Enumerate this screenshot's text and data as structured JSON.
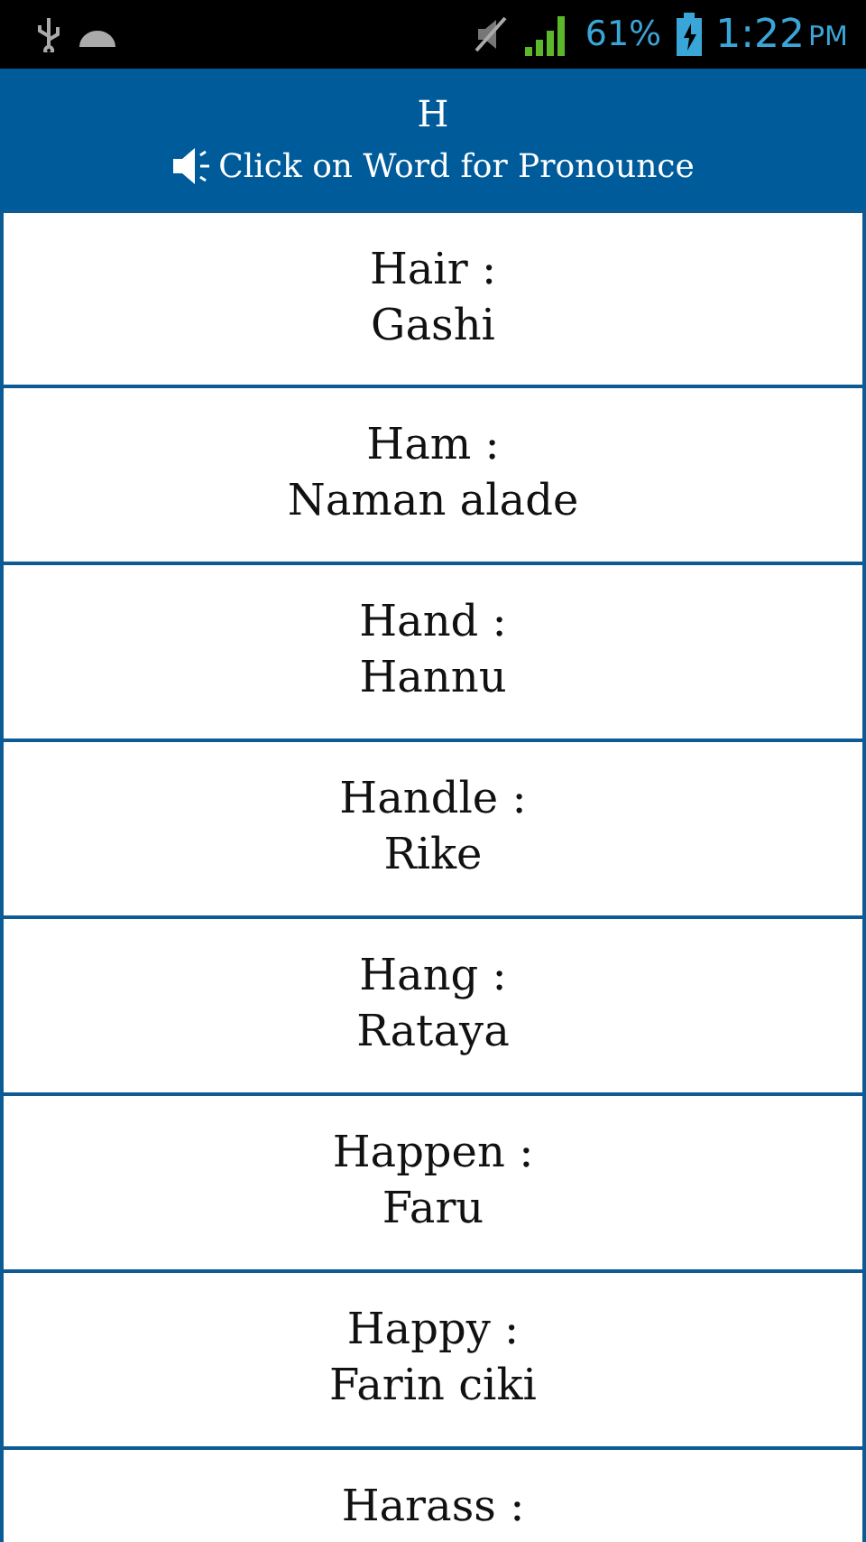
{
  "status_bar": {
    "battery": "61%",
    "time": "1:22",
    "ampm": "PM"
  },
  "header": {
    "title": "H",
    "hint": "Click on Word for Pronounce"
  },
  "entries": [
    {
      "word": "Hair :",
      "translation": "Gashi"
    },
    {
      "word": "Ham :",
      "translation": "Naman alade"
    },
    {
      "word": "Hand :",
      "translation": "Hannu"
    },
    {
      "word": "Handle :",
      "translation": "Rike"
    },
    {
      "word": "Hang :",
      "translation": "Rataya"
    },
    {
      "word": "Happen :",
      "translation": "Faru"
    },
    {
      "word": "Happy :",
      "translation": "Farin ciki"
    },
    {
      "word": "Harass :"
    }
  ]
}
